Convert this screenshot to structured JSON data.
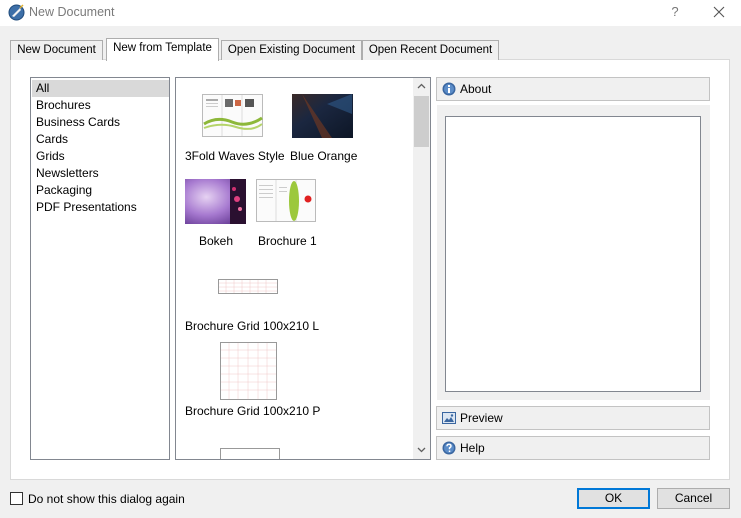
{
  "window": {
    "title": "New Document",
    "help_glyph": "?",
    "close_glyph": "✕"
  },
  "tabs": [
    {
      "label": "New Document",
      "active": false
    },
    {
      "label": "New from Template",
      "active": true
    },
    {
      "label": "Open Existing Document",
      "active": false
    },
    {
      "label": "Open Recent Document",
      "active": false
    }
  ],
  "categories": {
    "selected": "All",
    "items": [
      "All",
      "Brochures",
      "Business Cards",
      "Cards",
      "Grids",
      "Newsletters",
      "Packaging",
      "PDF Presentations"
    ]
  },
  "templates": [
    {
      "name": "3Fold Waves Style",
      "icon": "tri-fold-brochure-thumbnail"
    },
    {
      "name": "Blue Orange",
      "icon": "dark-gradient-thumbnail"
    },
    {
      "name": "Bokeh",
      "icon": "bokeh-thumbnail"
    },
    {
      "name": "Brochure 1",
      "icon": "brochure-thumbnail"
    },
    {
      "name": "Brochure Grid 100x210 L",
      "icon": "landscape-grid-thumbnail"
    },
    {
      "name": "Brochure Grid 100x210 P",
      "icon": "portrait-grid-thumbnail"
    }
  ],
  "side_panel": {
    "about_label": "About",
    "preview_label": "Preview",
    "help_label": "Help"
  },
  "footer": {
    "dont_show_label": "Do not show this dialog again",
    "dont_show_checked": false,
    "ok_label": "OK",
    "cancel_label": "Cancel"
  },
  "colors": {
    "accent": "#0078d7",
    "selection": "#d9d9d9"
  }
}
